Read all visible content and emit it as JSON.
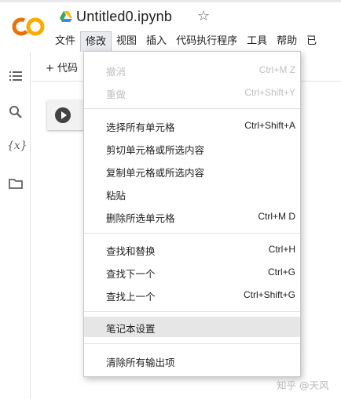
{
  "notebook": {
    "title": "Untitled0.ipynb"
  },
  "menubar": {
    "items": [
      {
        "label": "文件"
      },
      {
        "label": "修改"
      },
      {
        "label": "视图"
      },
      {
        "label": "插入"
      },
      {
        "label": "代码执行程序"
      },
      {
        "label": "工具"
      },
      {
        "label": "帮助"
      },
      {
        "label": "已"
      }
    ],
    "active_index": 1
  },
  "toolbar": {
    "add_code_label": "+ 代码"
  },
  "edit_menu": {
    "groups": [
      [
        {
          "label": "撤消",
          "shortcut": "Ctrl+M Z",
          "disabled": true
        },
        {
          "label": "重做",
          "shortcut": "Ctrl+Shift+Y",
          "disabled": true
        }
      ],
      [
        {
          "label": "选择所有单元格",
          "shortcut": "Ctrl+Shift+A"
        },
        {
          "label": "剪切单元格或所选内容",
          "shortcut": ""
        },
        {
          "label": "复制单元格或所选内容",
          "shortcut": ""
        },
        {
          "label": "粘贴",
          "shortcut": ""
        },
        {
          "label": "删除所选单元格",
          "shortcut": "Ctrl+M D"
        }
      ],
      [
        {
          "label": "查找和替换",
          "shortcut": "Ctrl+H"
        },
        {
          "label": "查找下一个",
          "shortcut": "Ctrl+G"
        },
        {
          "label": "查找上一个",
          "shortcut": "Ctrl+Shift+G"
        }
      ],
      [
        {
          "label": "笔记本设置",
          "shortcut": "",
          "highlighted": true
        }
      ],
      [
        {
          "label": "清除所有输出项",
          "shortcut": ""
        }
      ]
    ]
  },
  "sidebar": {
    "icons": [
      "table-of-contents-icon",
      "search-icon",
      "variables-icon",
      "folder-icon"
    ],
    "variables_label": "{x}"
  },
  "watermark": {
    "text": "知乎 @天风"
  },
  "colors": {
    "logo_orange": "#f9ab00",
    "logo_dark_orange": "#e8710a",
    "menu_highlight": "#e6e6e6"
  }
}
